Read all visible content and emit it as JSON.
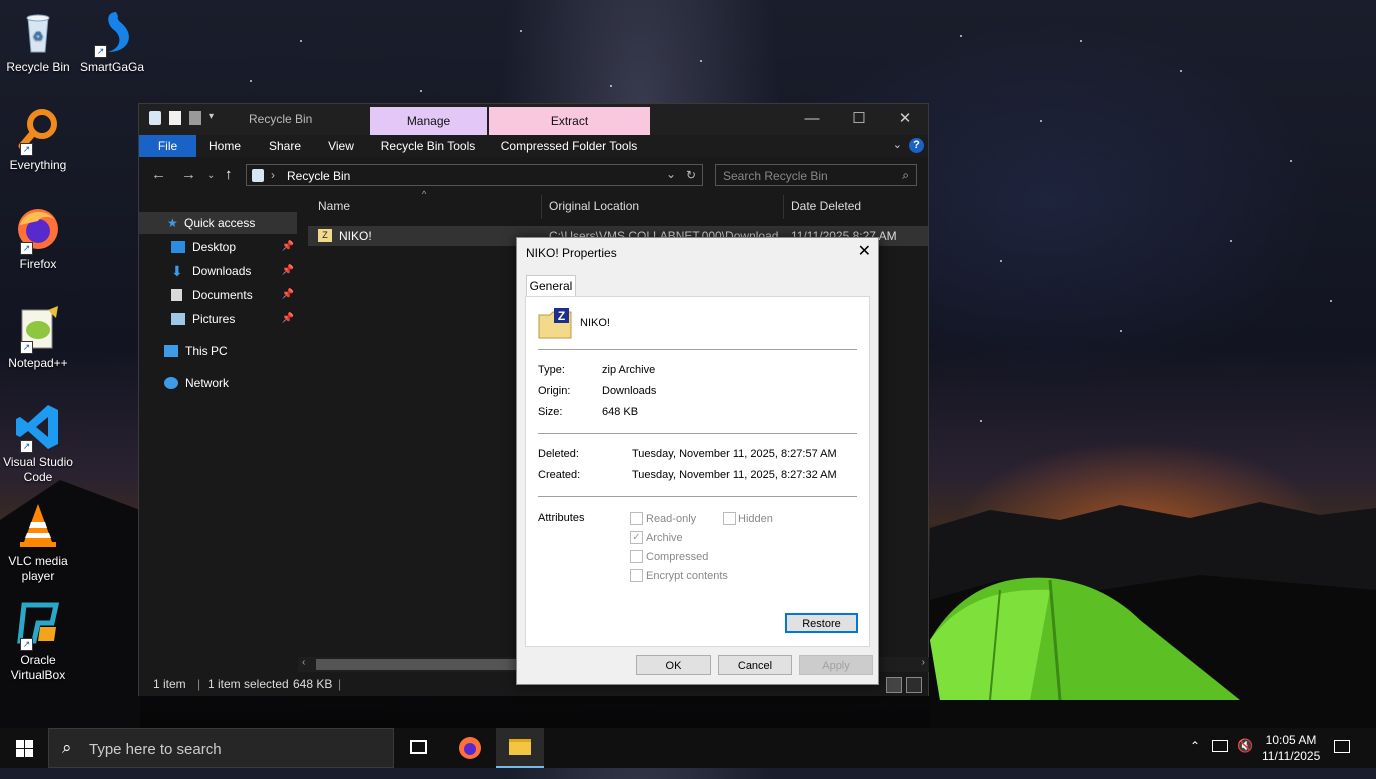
{
  "desktop": {
    "icons": [
      {
        "label": "Recycle Bin",
        "icon": "recycle-bin-icon"
      },
      {
        "label": "SmartGaGa",
        "icon": "smartgaga-icon"
      },
      {
        "label": "Everything",
        "icon": "everything-icon"
      },
      {
        "label": "Firefox",
        "icon": "firefox-icon"
      },
      {
        "label": "Notepad++",
        "icon": "notepad-plus-plus-icon"
      },
      {
        "label": "Visual Studio Code",
        "icon": "vscode-icon"
      },
      {
        "label": "VLC media player",
        "icon": "vlc-icon"
      },
      {
        "label": "Oracle VirtualBox",
        "icon": "virtualbox-icon"
      }
    ]
  },
  "explorer": {
    "title": "Recycle Bin",
    "context_tabs": {
      "manage": "Manage",
      "extract": "Extract"
    },
    "ribbon_tabs": [
      "File",
      "Home",
      "Share",
      "View",
      "Recycle Bin Tools",
      "Compressed Folder Tools"
    ],
    "address": {
      "path": "Recycle Bin"
    },
    "search_placeholder": "Search Recycle Bin",
    "nav": {
      "quick_access": "Quick access",
      "items": [
        "Desktop",
        "Downloads",
        "Documents",
        "Pictures"
      ],
      "this_pc": "This PC",
      "network": "Network"
    },
    "columns": {
      "name": "Name",
      "original_location": "Original Location",
      "date_deleted": "Date Deleted"
    },
    "rows": [
      {
        "name": "NIKO!",
        "original_location": "C:\\Users\\VMS.COLLABNET.000\\Downloads",
        "date_deleted": "11/11/2025 8:27 AM"
      }
    ],
    "status": {
      "items": "1 item",
      "selected": "1 item selected",
      "size": "648 KB"
    }
  },
  "dialog": {
    "title": "NIKO! Properties",
    "tab": "General",
    "file_name": "NIKO!",
    "labels": {
      "type": "Type:",
      "origin": "Origin:",
      "size": "Size:",
      "deleted": "Deleted:",
      "created": "Created:",
      "attributes": "Attributes"
    },
    "values": {
      "type": "zip Archive",
      "origin": "Downloads",
      "size": "648 KB",
      "deleted": "Tuesday, November 11, 2025, 8:27:57 AM",
      "created": "Tuesday, November 11, 2025, 8:27:32 AM"
    },
    "attributes": {
      "read_only": "Read-only",
      "hidden": "Hidden",
      "archive": "Archive",
      "compressed": "Compressed",
      "encrypt": "Encrypt contents"
    },
    "buttons": {
      "restore": "Restore",
      "ok": "OK",
      "cancel": "Cancel",
      "apply": "Apply"
    }
  },
  "taskbar": {
    "search_placeholder": "Type here to search",
    "time": "10:05 AM",
    "date": "11/11/2025"
  }
}
